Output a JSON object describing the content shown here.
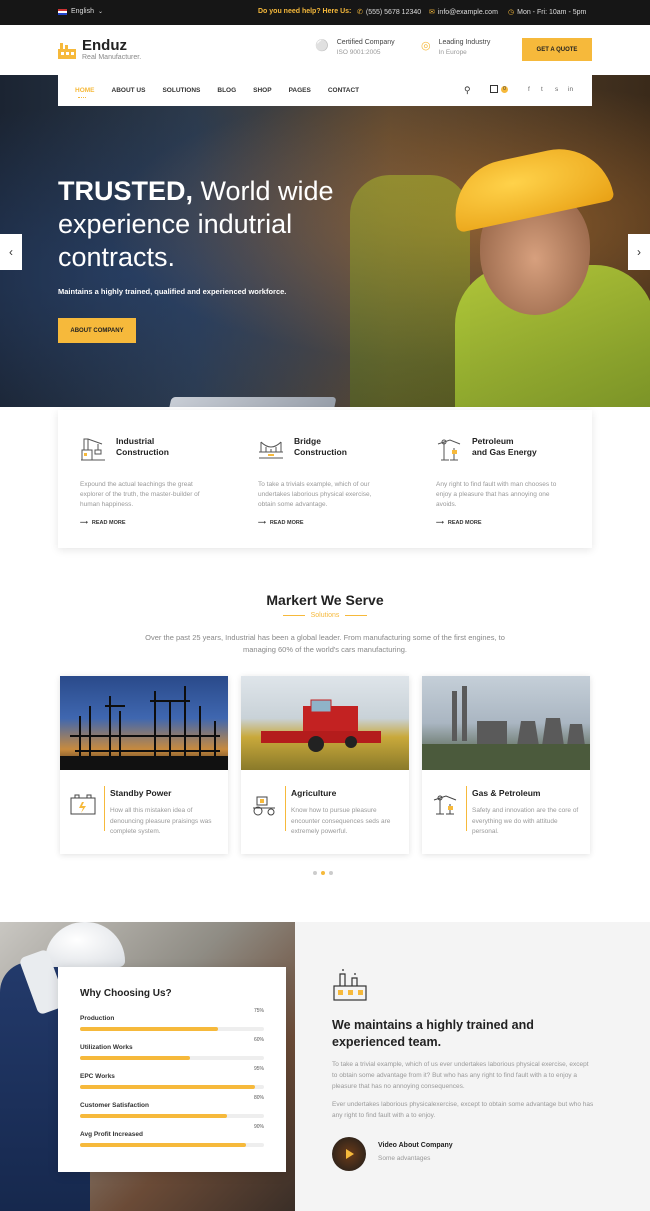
{
  "topbar": {
    "language": "English",
    "help_label": "Do you need help? Here Us:",
    "phone": "(555) 5678 12340",
    "email": "info@example.com",
    "hours": "Mon - Fri: 10am - 5pm"
  },
  "brand": {
    "name": "Enduz",
    "tagline": "Real Manufacturer."
  },
  "header": {
    "info": [
      {
        "title": "Certified Company",
        "sub": "ISO 9001:2005"
      },
      {
        "title": "Leading Industry",
        "sub": "In Europe"
      }
    ],
    "quote_button": "GET A QUOTE"
  },
  "nav": {
    "items": [
      "HOME",
      "ABOUT US",
      "SOLUTIONS",
      "BLOG",
      "SHOP",
      "PAGES",
      "CONTACT"
    ],
    "cart_count": "0",
    "social": [
      "f",
      "t",
      "s",
      "in"
    ]
  },
  "hero": {
    "title_bold": "TRUSTED,",
    "title_rest": " World wide experience indutrial contracts.",
    "subtitle": "Maintains a highly trained, qualified and experienced workforce.",
    "button": "ABOUT COMPANY"
  },
  "features": [
    {
      "title_line1": "Industrial",
      "title_line2": "Construction",
      "desc": "Expound the actual teachings the great explorer of the truth, the master-builder of human happiness.",
      "link": "READ MORE",
      "icon": "crane-icon"
    },
    {
      "title_line1": "Bridge",
      "title_line2": "Construction",
      "desc": "To take a trivials example, which of our undertakes laborious physical exercise, obtain some advantage.",
      "link": "READ MORE",
      "icon": "bridge-icon"
    },
    {
      "title_line1": "Petroleum",
      "title_line2": "and Gas Energy",
      "desc": "Any right to find fault with man chooses to enjoy a pleasure that has annoying one avoids.",
      "link": "READ MORE",
      "icon": "oil-pump-icon"
    }
  ],
  "market": {
    "title": "Markert We Serve",
    "subtitle": "Solutions",
    "desc": "Over the past 25 years, Industrial has been a global leader. From manufacturing some of the first engines, to managing 60% of the world's cars manufacturing.",
    "cards": [
      {
        "title": "Standby Power",
        "desc": "How all this mistaken idea of denouncing pleasure praisings was complete system.",
        "icon": "power-icon"
      },
      {
        "title": "Agriculture",
        "desc": "Know how to pursue pleasure encounter consequences seds are extremely powerful.",
        "icon": "tractor-icon"
      },
      {
        "title": "Gas & Petroleum",
        "desc": "Safety and innovation are the core of everything we do with attitude personal.",
        "icon": "oil-pump-icon"
      }
    ]
  },
  "why": {
    "title": "Why Choosing Us?",
    "bars": [
      {
        "label": "Production",
        "percent": "75%",
        "value": 75
      },
      {
        "label": "Utilization Works",
        "percent": "60%",
        "value": 60
      },
      {
        "label": "EPC Works",
        "percent": "95%",
        "value": 95
      },
      {
        "label": "Customer Satisfaction",
        "percent": "80%",
        "value": 80
      },
      {
        "label": "Avg Profit Increased",
        "percent": "90%",
        "value": 90
      }
    ]
  },
  "about": {
    "title": "We maintains a highly trained and experienced team.",
    "p1": "To take a trivial example, which of us ever undertakes laborious physical exercise, except to obtain some advantage from it? But who has any right to find fault with a to enjoy a pleasure that has no annoying consequences.",
    "p2": "Ever undertakes laborious physicalexercise, except to obtain some advantage but who has any right to find fault with a to enjoy.",
    "video_title": "Video About Company",
    "video_sub": "Some advantages"
  },
  "colors": {
    "accent": "#f6b93b",
    "dark": "#161616"
  }
}
